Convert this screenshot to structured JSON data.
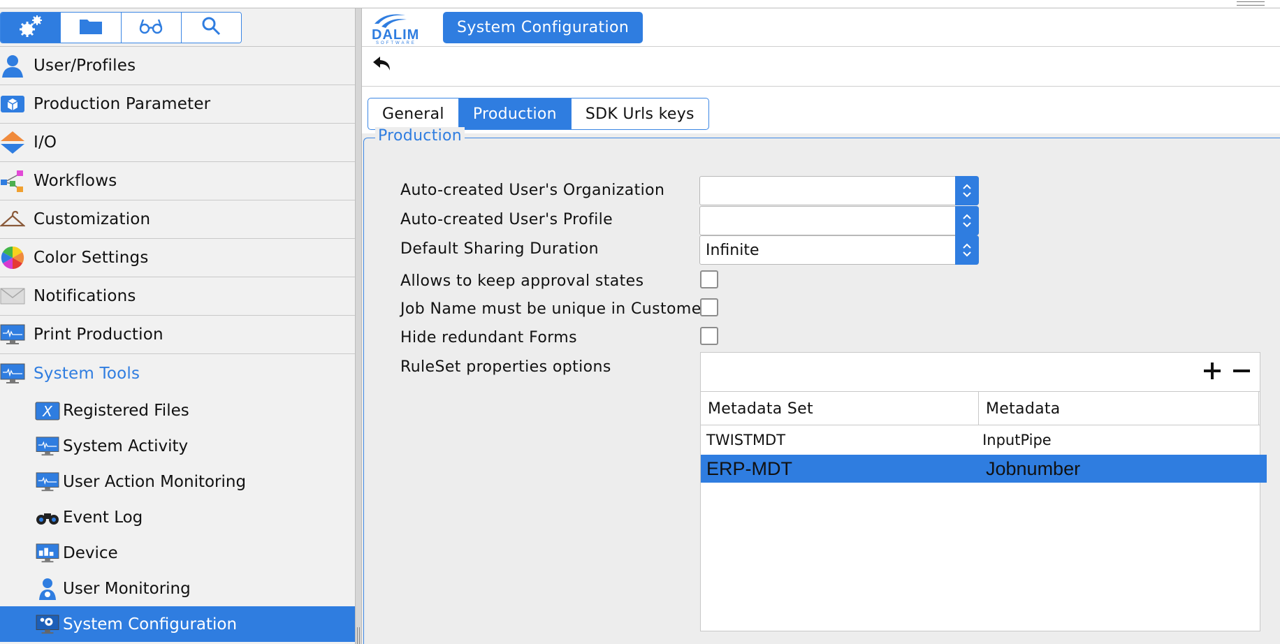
{
  "sidebar": {
    "mode_buttons": [
      {
        "name": "settings-mode",
        "icon": "gears-icon",
        "active": true
      },
      {
        "name": "files-mode",
        "icon": "folder-icon",
        "active": false
      },
      {
        "name": "review-mode",
        "icon": "glasses-icon",
        "active": false
      },
      {
        "name": "search-mode",
        "icon": "search-icon",
        "active": false
      }
    ],
    "items": [
      {
        "label": "User/Profiles",
        "icon": "user-icon"
      },
      {
        "label": "Production Parameter",
        "icon": "package-icon"
      },
      {
        "label": "I/O",
        "icon": "io-arrows-icon"
      },
      {
        "label": "Workflows",
        "icon": "workflow-icon"
      },
      {
        "label": "Customization",
        "icon": "hanger-icon"
      },
      {
        "label": "Color Settings",
        "icon": "color-wheel-icon"
      },
      {
        "label": "Notifications",
        "icon": "envelope-icon"
      },
      {
        "label": "Print Production",
        "icon": "monitor-icon"
      },
      {
        "label": "System Tools",
        "icon": "monitor-icon"
      }
    ],
    "sub_items": [
      {
        "label": "Registered Files",
        "icon": "registered-files-icon"
      },
      {
        "label": "System Activity",
        "icon": "monitor-icon"
      },
      {
        "label": "User Action Monitoring",
        "icon": "monitor-icon"
      },
      {
        "label": "Event Log",
        "icon": "binoculars-icon"
      },
      {
        "label": "Device",
        "icon": "device-monitor-icon"
      },
      {
        "label": "User Monitoring",
        "icon": "user-monitor-icon"
      },
      {
        "label": "System Configuration",
        "icon": "system-config-icon"
      }
    ],
    "selected_sub_item": "System Configuration"
  },
  "header": {
    "logo": "dalim-software-logo",
    "title": "System Configuration"
  },
  "toolbar": {
    "back_icon": "undo-arrow-icon"
  },
  "tabs": [
    {
      "label": "General",
      "active": false
    },
    {
      "label": "Production",
      "active": true
    },
    {
      "label": "SDK Urls keys",
      "active": false
    }
  ],
  "production": {
    "legend": "Production",
    "fields": {
      "org_label": "Auto-created User's Organization",
      "org_value": "",
      "profile_label": "Auto-created User's Profile",
      "profile_value": "",
      "sharing_label": "Default Sharing Duration",
      "sharing_value": "Infinite",
      "keep_approval_label": "Allows to keep approval states",
      "keep_approval_checked": false,
      "unique_job_label": "Job Name must be unique in Customer",
      "unique_job_checked": false,
      "hide_forms_label": "Hide redundant Forms",
      "hide_forms_checked": false,
      "ruleset_label": "RuleSet properties options"
    },
    "ruleset_table": {
      "columns": [
        "Metadata Set",
        "Metadata"
      ],
      "rows": [
        {
          "metadata_set": "TWISTMDT",
          "metadata": "InputPipe",
          "selected": false
        },
        {
          "metadata_set": "ERP-MDT",
          "metadata": "Jobnumber",
          "selected": true
        }
      ]
    }
  },
  "colors": {
    "accent": "#2f7de0",
    "sidebar_bg": "#f1f1f1",
    "panel_bg": "#ededed"
  }
}
